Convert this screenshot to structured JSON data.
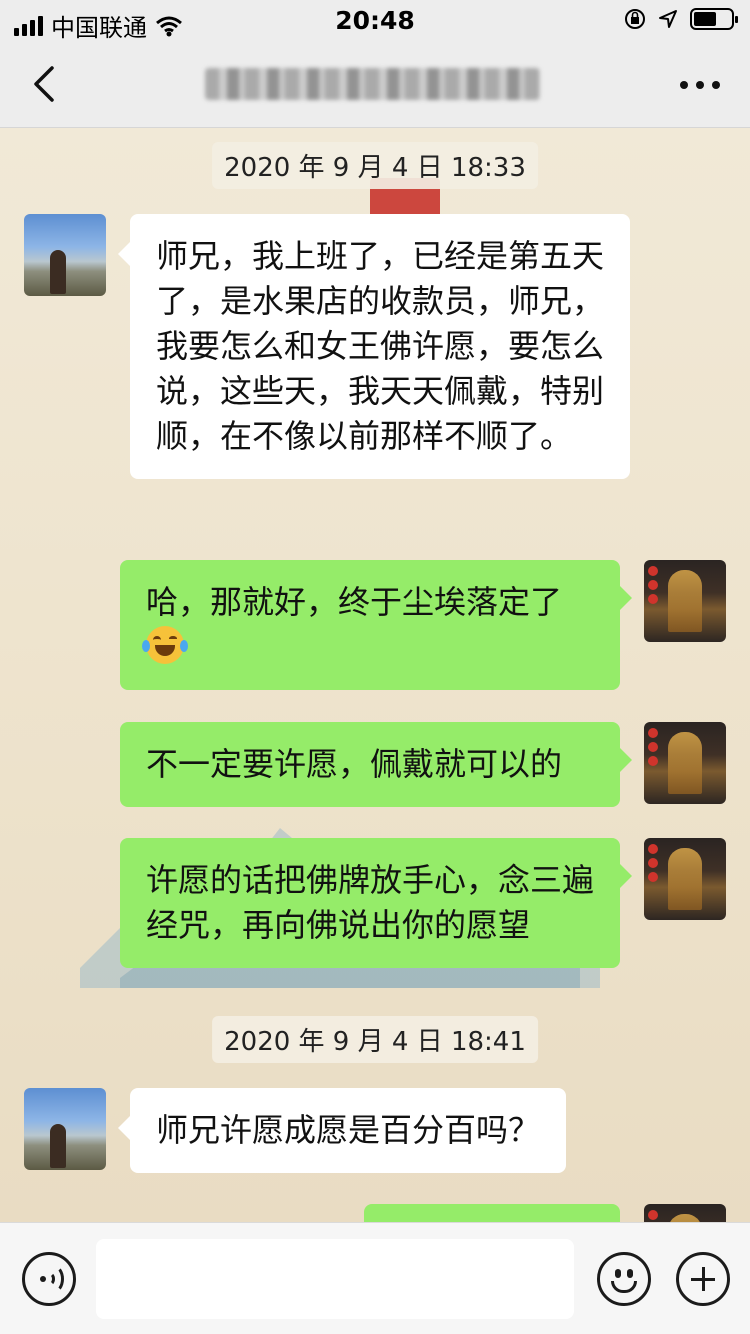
{
  "status_bar": {
    "carrier": "中国联通",
    "time": "20:48"
  },
  "nav": {
    "icons": {
      "back": "chevron-left-icon",
      "more": "more-dots-icon"
    }
  },
  "messages": {
    "time1": "2020 年 9 月 4 日 18:33",
    "msg1": "师兄，我上班了，已经是第五天了，是水果店的收款员，师兄，我要怎么和女王佛许愿，要怎么说，这些天，我天天佩戴，特别顺，在不像以前那样不顺了。",
    "msg2": "哈，那就好，终于尘埃落定了",
    "msg2_emoji": "laughing-tears-emoji",
    "msg3": "不一定要许愿，佩戴就可以的",
    "msg4": "许愿的话把佛牌放手心，念三遍经咒，再向佛说出你的愿望",
    "time2": "2020 年 9 月 4 日 18:41",
    "msg5": "师兄许愿成愿是百分百吗？"
  },
  "input_bar": {
    "icons": {
      "voice": "voice-icon",
      "emoji": "smiley-icon",
      "plus": "plus-icon"
    },
    "placeholder": ""
  },
  "colors": {
    "sent_bubble": "#95ec69",
    "received_bubble": "#ffffff",
    "bar_background": "#ededed"
  }
}
